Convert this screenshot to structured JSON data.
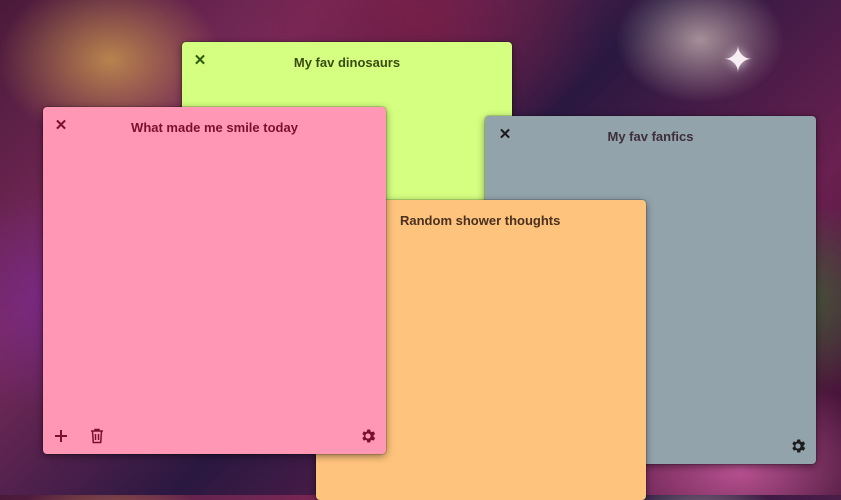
{
  "notes": {
    "dinosaurs": {
      "title": "My fav dinosaurs",
      "color": "#d4ff80"
    },
    "fanfics": {
      "title": "My fav fanfics",
      "color": "#93a3ac"
    },
    "shower": {
      "title": "Random shower thoughts",
      "color": "#fec37c"
    },
    "smile": {
      "title": "What made me smile today",
      "color": "#ff97b5"
    }
  },
  "icons": {
    "close": "close-icon",
    "add": "plus-icon",
    "delete": "trash-icon",
    "settings": "gear-icon",
    "wallpaper_star": "sparkle-icon"
  }
}
